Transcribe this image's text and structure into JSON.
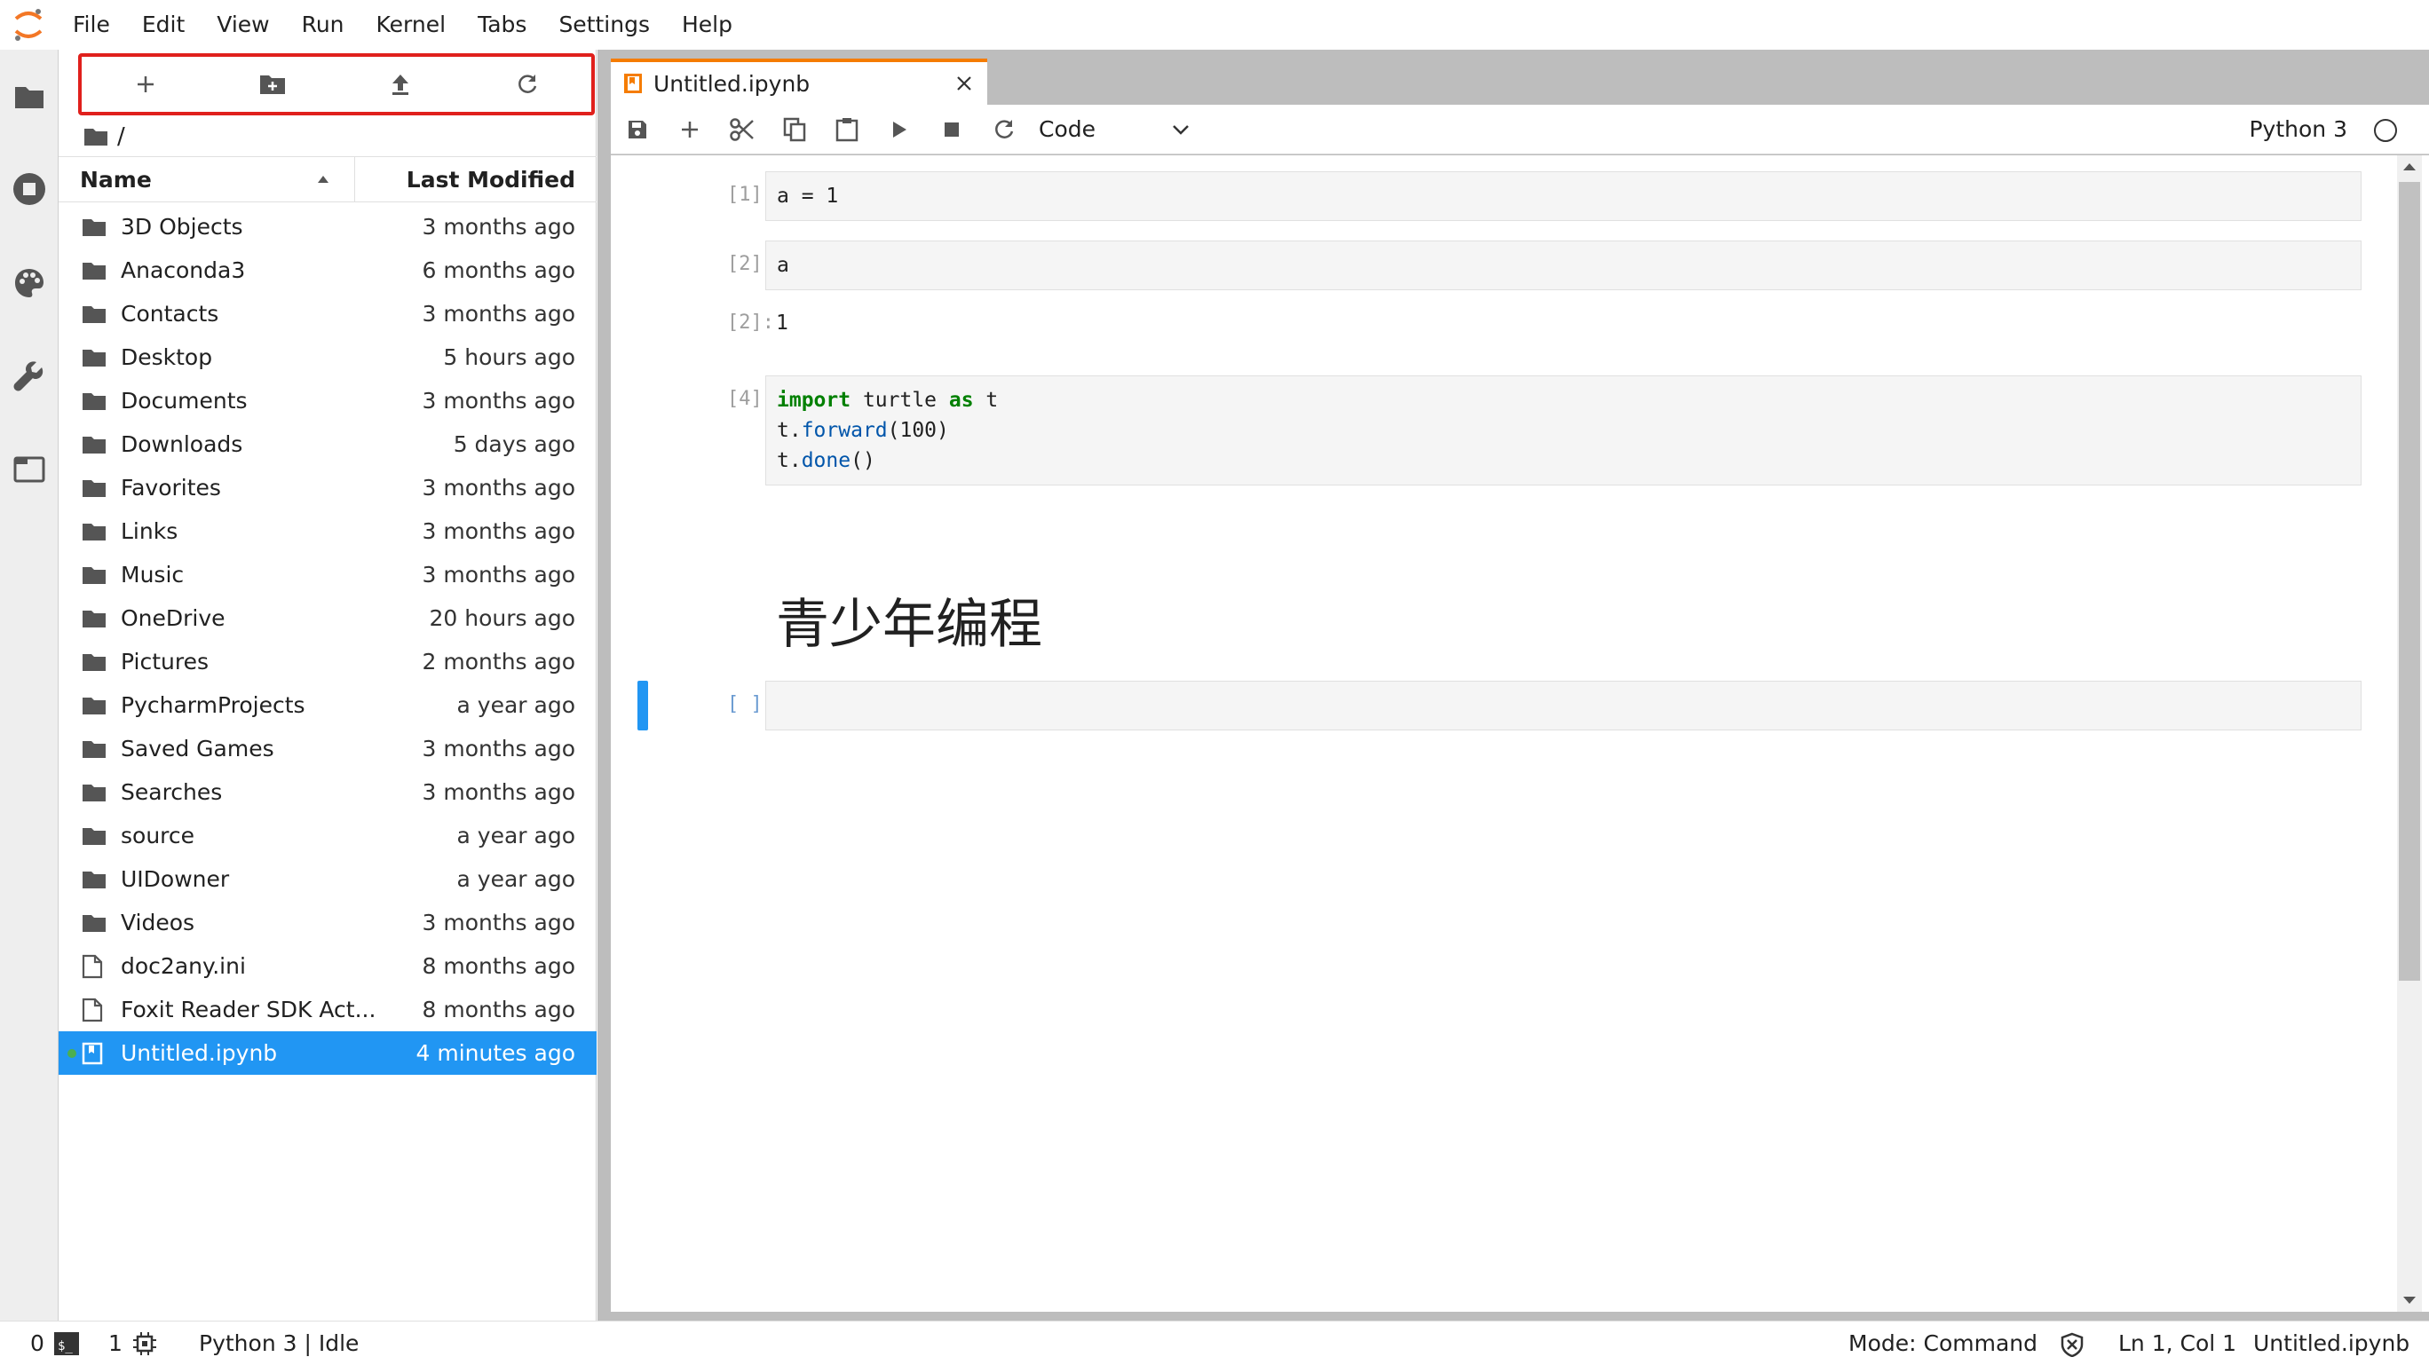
{
  "menu": [
    "File",
    "Edit",
    "View",
    "Run",
    "Kernel",
    "Tabs",
    "Settings",
    "Help"
  ],
  "activity_icons": [
    "folder-icon",
    "running-icon",
    "palette-icon",
    "wrench-icon",
    "tabs-icon"
  ],
  "file_browser": {
    "toolbar": [
      "new-launcher-icon",
      "new-folder-icon",
      "upload-icon",
      "refresh-icon"
    ],
    "breadcrumb": "/",
    "header": {
      "name": "Name",
      "modified": "Last Modified"
    },
    "files": [
      {
        "name": "3D Objects",
        "modified": "3 months ago",
        "type": "folder"
      },
      {
        "name": "Anaconda3",
        "modified": "6 months ago",
        "type": "folder"
      },
      {
        "name": "Contacts",
        "modified": "3 months ago",
        "type": "folder"
      },
      {
        "name": "Desktop",
        "modified": "5 hours ago",
        "type": "folder"
      },
      {
        "name": "Documents",
        "modified": "3 months ago",
        "type": "folder"
      },
      {
        "name": "Downloads",
        "modified": "5 days ago",
        "type": "folder"
      },
      {
        "name": "Favorites",
        "modified": "3 months ago",
        "type": "folder"
      },
      {
        "name": "Links",
        "modified": "3 months ago",
        "type": "folder"
      },
      {
        "name": "Music",
        "modified": "3 months ago",
        "type": "folder"
      },
      {
        "name": "OneDrive",
        "modified": "20 hours ago",
        "type": "folder"
      },
      {
        "name": "Pictures",
        "modified": "2 months ago",
        "type": "folder"
      },
      {
        "name": "PycharmProjects",
        "modified": "a year ago",
        "type": "folder"
      },
      {
        "name": "Saved Games",
        "modified": "3 months ago",
        "type": "folder"
      },
      {
        "name": "Searches",
        "modified": "3 months ago",
        "type": "folder"
      },
      {
        "name": "source",
        "modified": "a year ago",
        "type": "folder"
      },
      {
        "name": "UIDowner",
        "modified": "a year ago",
        "type": "folder"
      },
      {
        "name": "Videos",
        "modified": "3 months ago",
        "type": "folder"
      },
      {
        "name": "doc2any.ini",
        "modified": "8 months ago",
        "type": "file"
      },
      {
        "name": "Foxit Reader SDK Act...",
        "modified": "8 months ago",
        "type": "file"
      },
      {
        "name": "Untitled.ipynb",
        "modified": "4 minutes ago",
        "type": "notebook",
        "selected": true
      }
    ]
  },
  "tab": {
    "title": "Untitled.ipynb"
  },
  "notebook_toolbar": {
    "tools": [
      "save-icon",
      "add-cell-icon",
      "cut-icon",
      "copy-icon",
      "paste-icon",
      "run-icon",
      "stop-icon",
      "restart-icon"
    ],
    "cell_type": "Code",
    "kernel": "Python 3"
  },
  "cells": {
    "c1": {
      "prompt": "[1]:",
      "code": "a = 1"
    },
    "c2": {
      "prompt": "[2]:",
      "code": "a",
      "out_prompt": "[2]:",
      "output": "1"
    },
    "c3": {
      "prompt": "[4]:",
      "line1_a": "import",
      "line1_b": " turtle ",
      "line1_c": "as",
      "line1_d": " t",
      "line2_a": "t.",
      "line2_b": "forward",
      "line2_c": "(100)",
      "line3_a": "t.",
      "line3_b": "done",
      "line3_c": "()"
    },
    "md": {
      "text": "青少年编程"
    },
    "c5": {
      "prompt": "[ ]:"
    }
  },
  "statusbar": {
    "terminals": "0",
    "kernels": "1",
    "kernel_status": "Python 3 | Idle",
    "mode": "Mode: Command",
    "position": "Ln 1, Col 1",
    "file": "Untitled.ipynb"
  },
  "colors": {
    "accent": "#2196f3",
    "highlight_border": "#e0201c",
    "tab_accent": "#f57c00"
  }
}
